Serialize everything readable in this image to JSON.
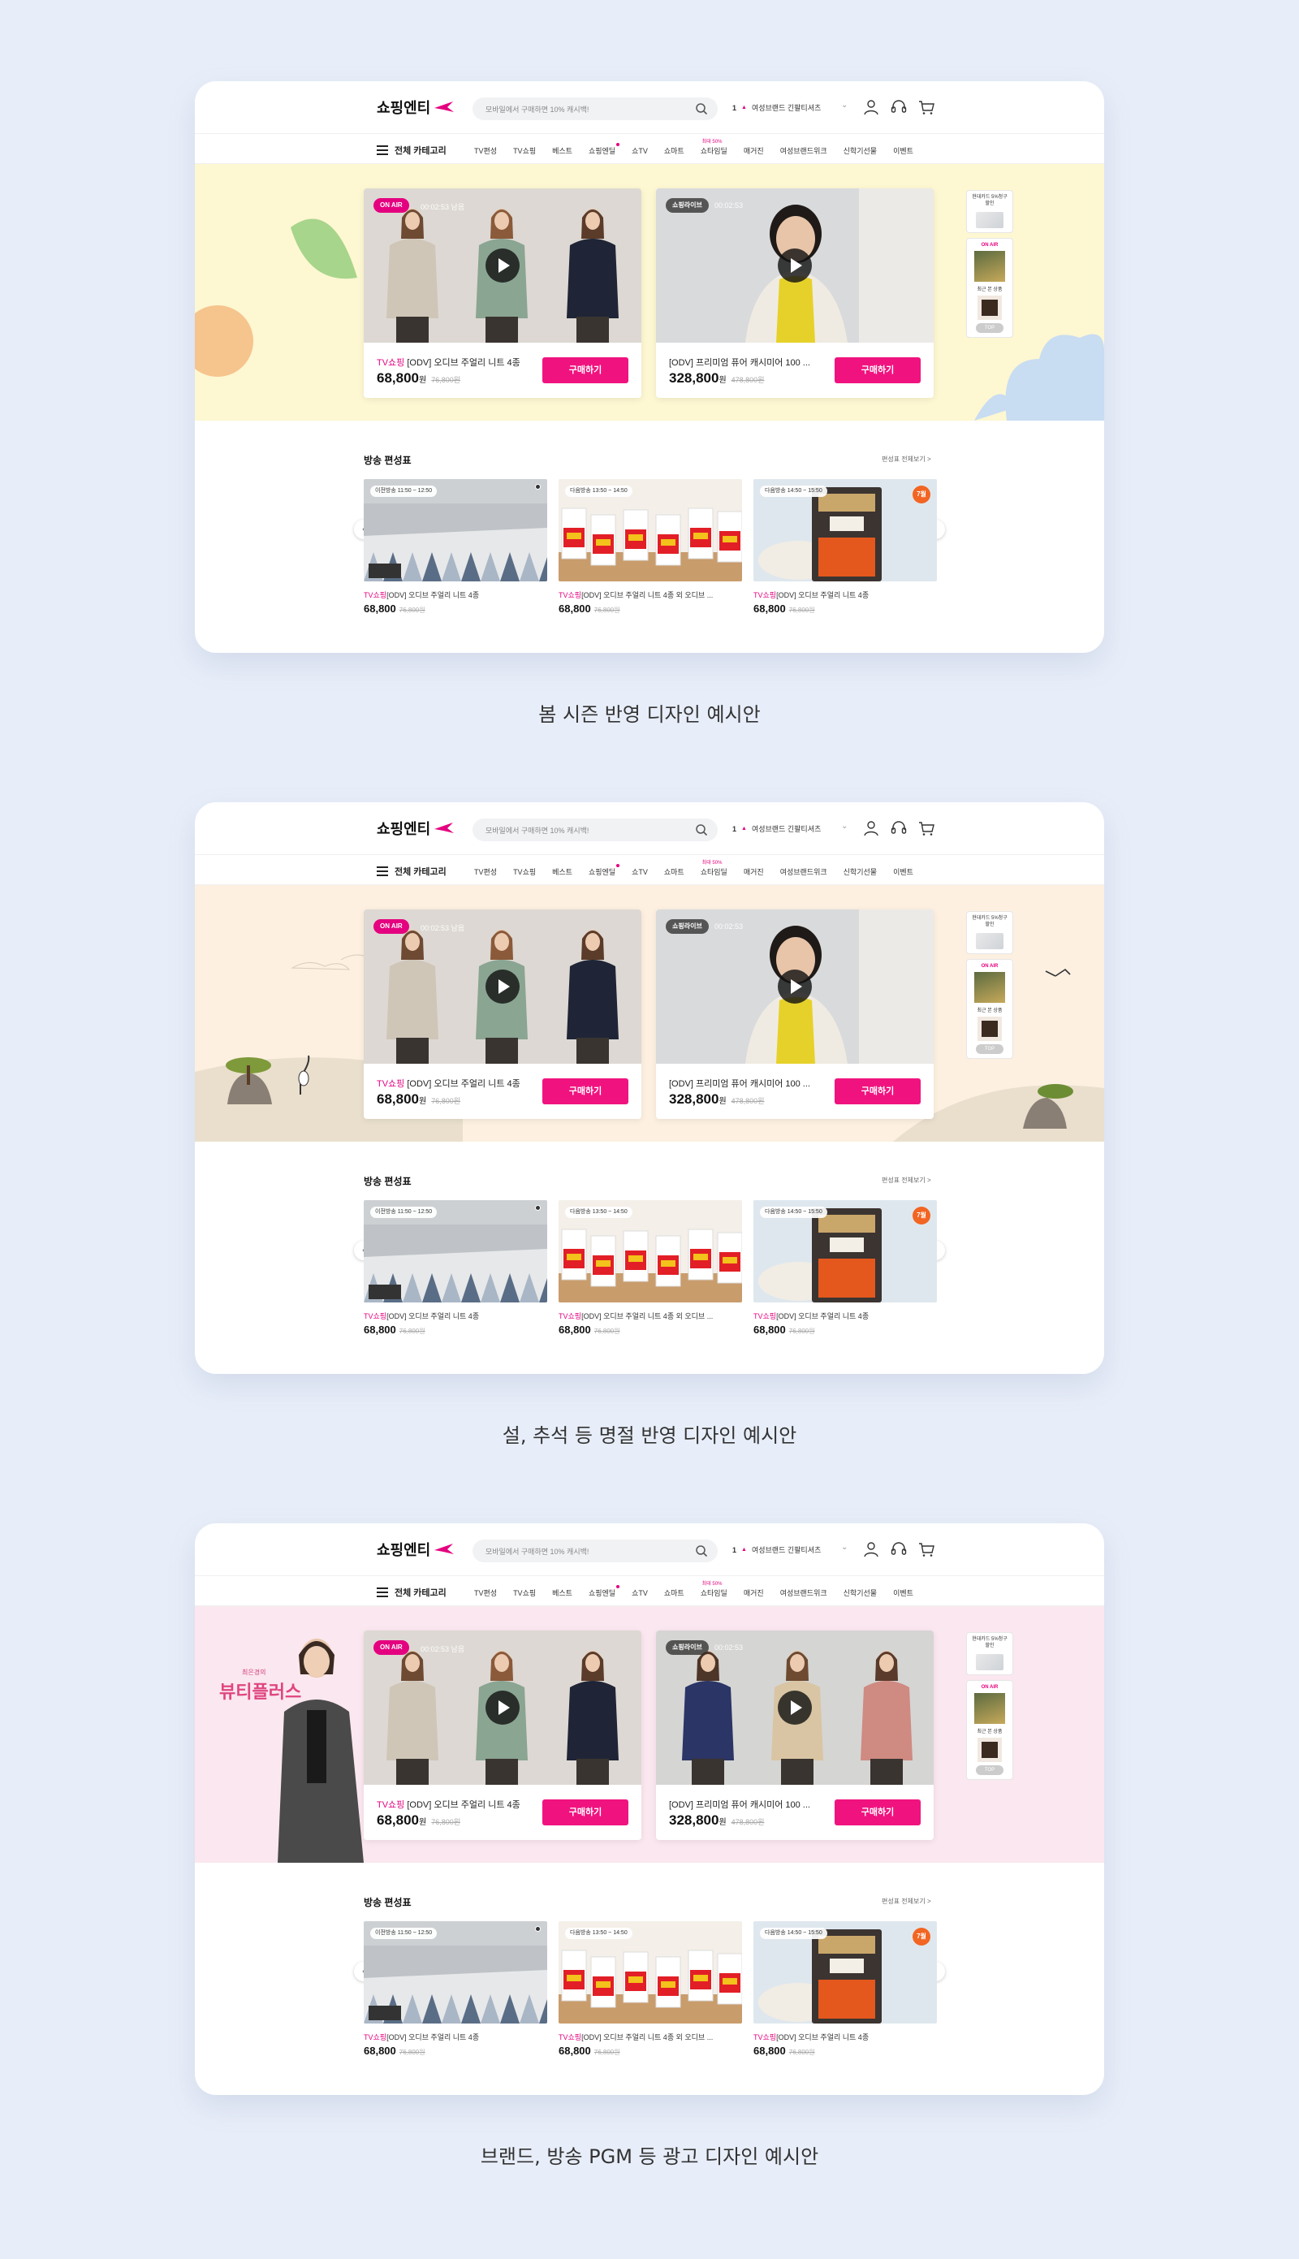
{
  "site": {
    "logo_text": "쇼핑엔티",
    "search_placeholder": "모바일에서 구매하면 10% 캐시백!",
    "ticker_rank": "1",
    "ticker_text": "여성브랜드 긴팔티셔츠",
    "all_category": "전체 카테고리",
    "gnb": [
      "TV편성",
      "TV쇼핑",
      "베스트",
      "쇼핑엔딜",
      "쇼TV",
      "쇼마트",
      "쇼타임딜",
      "매거진",
      "여성브랜드위크",
      "신학기선물",
      "이벤트"
    ],
    "gnb_tag": "최대 50%"
  },
  "hero": {
    "card1": {
      "badge": "ON AIR",
      "time": "00:02:53 남음",
      "channel": "TV쇼핑",
      "title": "[ODV] 오디브 주얼리 니트 4종",
      "price": "68,800",
      "won": "원",
      "orig_price": "76,800원",
      "buy": "구매하기"
    },
    "card2": {
      "badge": "쇼핑라이브",
      "time": "00:02:53",
      "title": "[ODV] 프리미엄 퓨어 캐시미어 100 ...",
      "price": "328,800",
      "won": "원",
      "orig_price": "478,800원",
      "buy": "구매하기"
    },
    "quick": {
      "card_title": "현대카드 5%청구할인",
      "on_air": "ON AIR",
      "recent": "최근 본 상품",
      "top": "TOP"
    }
  },
  "schedule": {
    "title": "방송 편성표",
    "more": "편성표 전체보기 >",
    "items": [
      {
        "badge": "이전방송 11:50 ~ 12:50",
        "channel": "TV쇼핑",
        "name": "[ODV] 오디브 주얼리 니트 4종",
        "price": "68,800",
        "orig": "76,800원"
      },
      {
        "badge": "다음방송 13:50 ~ 14:50",
        "channel": "TV쇼핑",
        "name": "[ODV] 오디브 주얼리 니트 4종 외 오디브 ...",
        "price": "68,800",
        "orig": "76,800원"
      },
      {
        "badge": "다음방송 14:50 ~ 15:50",
        "channel": "TV쇼핑",
        "name": "[ODV] 오디브 주얼리 니트 4종",
        "price": "68,800",
        "orig": "76,800원",
        "new_badge": "7월"
      }
    ]
  },
  "variants": [
    {
      "caption": "봄 시즌 반영 디자인 예시안"
    },
    {
      "caption": "설, 추석 등 명절 반영 디자인 예시안"
    },
    {
      "caption": "브랜드, 방송 PGM 등 광고 디자인 예시안",
      "brand_text": "뷰티플러스",
      "brand_sub": "최은경의"
    }
  ],
  "colors": {
    "accent": "#f0137f",
    "spring_bg": "#fdf7d2",
    "festival_bg": "#fdf0e1",
    "brand_bg": "#fbe7ef",
    "page_bg": "#e8eef9"
  }
}
